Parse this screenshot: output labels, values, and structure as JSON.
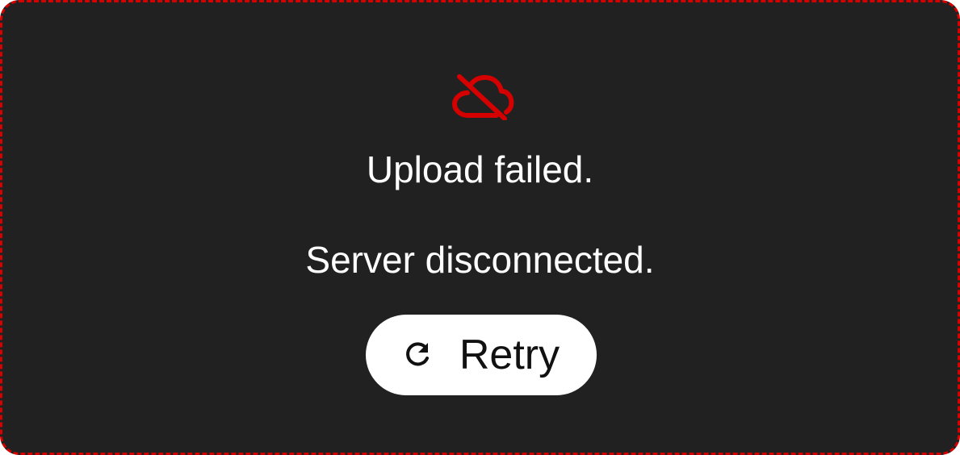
{
  "dialog": {
    "icon": "cloud-off-icon",
    "title": "Upload failed.",
    "message": "Server disconnected.",
    "retry_label": "Retry",
    "retry_icon": "refresh-icon"
  },
  "colors": {
    "background": "#212121",
    "border": "#d50000",
    "icon": "#d50000",
    "text": "#ffffff",
    "button_bg": "#ffffff",
    "button_text": "#111111"
  }
}
